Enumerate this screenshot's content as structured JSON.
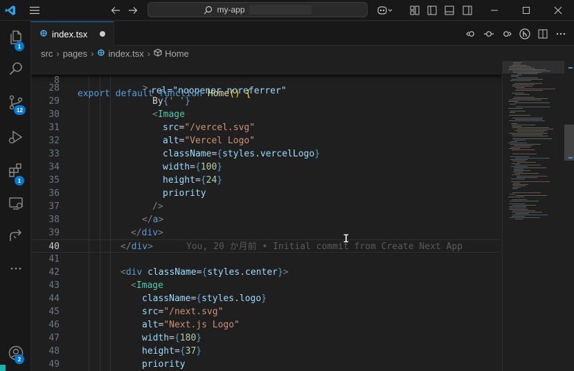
{
  "titlebar": {
    "search_text": "my-app",
    "icons": [
      "vscode-logo-icon",
      "menu-icon",
      "back-arrow-icon",
      "forward-arrow-icon",
      "search-icon",
      "copilot-icon",
      "layout-customize-icon",
      "toggle-primary-sidebar-icon",
      "toggle-panel-icon",
      "toggle-secondary-sidebar-icon",
      "minimize-icon",
      "maximize-icon",
      "close-icon"
    ]
  },
  "activity": {
    "items": [
      {
        "name": "explorer",
        "badge": "1"
      },
      {
        "name": "search",
        "badge": ""
      },
      {
        "name": "source-control",
        "badge": "12"
      },
      {
        "name": "run-debug",
        "badge": ""
      },
      {
        "name": "extensions",
        "badge": "1"
      },
      {
        "name": "remote-explorer",
        "badge": ""
      },
      {
        "name": "live-share",
        "badge": ""
      },
      {
        "name": "more",
        "badge": ""
      }
    ],
    "accounts_badge": "2"
  },
  "tab": {
    "label": "index.tsx",
    "icon": "TS"
  },
  "breadcrumb": {
    "items": [
      "src",
      "pages",
      "index.tsx",
      "Home"
    ]
  },
  "editor": {
    "sticky": {
      "number": "8",
      "text": "export default function Home() {"
    },
    "partial_text": "rel=\"noopener noreferrer\"",
    "lines": [
      {
        "n": "28",
        "html": "<span class=\"punct\">></span>"
      },
      {
        "n": "29",
        "html": "By<span class=\"brace\">{</span><span class=\"str\">' '</span><span class=\"brace\">}</span>"
      },
      {
        "n": "30",
        "html": "<span class=\"punct\">&lt;</span><span class=\"tag\">Image</span>"
      },
      {
        "n": "31",
        "html": "<span class=\"attr\">src</span>=<span class=\"str\">\"/vercel.svg\"</span>"
      },
      {
        "n": "32",
        "html": "<span class=\"attr\">alt</span>=<span class=\"str\">\"Vercel Logo\"</span>"
      },
      {
        "n": "33",
        "html": "<span class=\"attr\">className</span>=<span class=\"brace\">{</span><span class=\"attr\">styles</span>.<span class=\"attr\">vercelLogo</span><span class=\"brace\">}</span>"
      },
      {
        "n": "34",
        "html": "<span class=\"attr\">width</span>=<span class=\"brace\">{</span><span class=\"num\">100</span><span class=\"brace\">}</span>"
      },
      {
        "n": "35",
        "html": "<span class=\"attr\">height</span>=<span class=\"brace\">{</span><span class=\"num\">24</span><span class=\"brace\">}</span>"
      },
      {
        "n": "36",
        "html": "<span class=\"attr\">priority</span>"
      },
      {
        "n": "37",
        "html": "<span class=\"punct\">/></span>"
      },
      {
        "n": "38",
        "html": "<span class=\"punct\">&lt;/</span><span class=\"kw\">a</span><span class=\"punct\">></span>"
      },
      {
        "n": "39",
        "html": "<span class=\"punct\">&lt;/</span><span class=\"kw\">div</span><span class=\"punct\">></span>"
      },
      {
        "n": "40",
        "html": "<span class=\"punct\">&lt;/</span><span class=\"kw\">div</span><span class=\"punct\">></span>"
      },
      {
        "n": "41",
        "html": ""
      },
      {
        "n": "42",
        "html": "<span class=\"punct\">&lt;</span><span class=\"kw\">div</span> <span class=\"attr\">className</span>=<span class=\"brace\">{</span><span class=\"attr\">styles</span>.<span class=\"attr\">center</span><span class=\"brace\">}</span><span class=\"punct\">></span>"
      },
      {
        "n": "43",
        "html": "<span class=\"punct\">&lt;</span><span class=\"tag\">Image</span>"
      },
      {
        "n": "44",
        "html": "<span class=\"attr\">className</span>=<span class=\"brace\">{</span><span class=\"attr\">styles</span>.<span class=\"attr\">logo</span><span class=\"brace\">}</span>"
      },
      {
        "n": "45",
        "html": "<span class=\"attr\">src</span>=<span class=\"str\">\"/next.svg\"</span>"
      },
      {
        "n": "46",
        "html": "<span class=\"attr\">alt</span>=<span class=\"str\">\"Next.js Logo\"</span>"
      },
      {
        "n": "47",
        "html": "<span class=\"attr\">width</span>=<span class=\"brace\">{</span><span class=\"num\">180</span><span class=\"brace\">}</span>"
      },
      {
        "n": "48",
        "html": "<span class=\"attr\">height</span>=<span class=\"brace\">{</span><span class=\"num\">37</span><span class=\"brace\">}</span>"
      },
      {
        "n": "49",
        "html": "<span class=\"attr\">priority</span>"
      }
    ],
    "current_line": "40",
    "blame": "You, 20 か月前 • Initial commit from Create Next App"
  },
  "colors": {
    "accent": "#0078d4",
    "background": "#1f1f1f",
    "sidebar": "#181818"
  }
}
